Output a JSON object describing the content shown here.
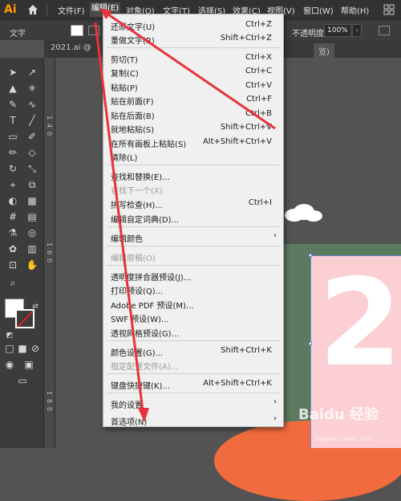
{
  "app": {
    "logo": "Ai"
  },
  "menubar": {
    "items": [
      "文件(F)",
      "编辑(E)",
      "对象(O)",
      "文字(T)",
      "选择(S)",
      "效果(C)",
      "视图(V)",
      "窗口(W)",
      "帮助(H)"
    ],
    "active_index": 1
  },
  "controlbar": {
    "text_label": "文字",
    "opacity_label": "不透明度:",
    "opacity_value": "100%"
  },
  "tabs": {
    "doc_tab": "2021.ai @",
    "second_tab": "览)"
  },
  "ruler": {
    "numbers": [
      "1",
      "4",
      "0",
      "1",
      "6",
      "0",
      "1",
      "8",
      "0"
    ]
  },
  "artwork": {
    "digit": "2"
  },
  "edit_menu": {
    "items": [
      {
        "label": "还原文字(U)",
        "shortcut": "Ctrl+Z"
      },
      {
        "label": "重做文字(R)",
        "shortcut": "Shift+Ctrl+Z"
      },
      {
        "label": "剪切(T)",
        "shortcut": "Ctrl+X"
      },
      {
        "label": "复制(C)",
        "shortcut": "Ctrl+C"
      },
      {
        "label": "粘贴(P)",
        "shortcut": "Ctrl+V"
      },
      {
        "label": "贴在前面(F)",
        "shortcut": "Ctrl+F"
      },
      {
        "label": "贴在后面(B)",
        "shortcut": "Ctrl+B"
      },
      {
        "label": "就地粘贴(S)",
        "shortcut": "Shift+Ctrl+V"
      },
      {
        "label": "在所有画板上粘贴(S)",
        "shortcut": "Alt+Shift+Ctrl+V"
      },
      {
        "label": "清除(L)",
        "shortcut": ""
      },
      {
        "label": "查找和替换(E)...",
        "shortcut": ""
      },
      {
        "label": "查找下一个(X)",
        "shortcut": ""
      },
      {
        "label": "拼写检查(H)...",
        "shortcut": "Ctrl+I"
      },
      {
        "label": "编辑自定词典(D)...",
        "shortcut": ""
      },
      {
        "label": "编辑颜色",
        "shortcut": ""
      },
      {
        "label": "编辑原稿(O)",
        "shortcut": ""
      },
      {
        "label": "透明度拼合器预设(J)...",
        "shortcut": ""
      },
      {
        "label": "打印预设(Q)...",
        "shortcut": ""
      },
      {
        "label": "Adobe PDF 预设(M)...",
        "shortcut": ""
      },
      {
        "label": "SWF 预设(W)...",
        "shortcut": ""
      },
      {
        "label": "透视网格预设(G)...",
        "shortcut": ""
      },
      {
        "label": "颜色设置(G)...",
        "shortcut": "Shift+Ctrl+K"
      },
      {
        "label": "指定配置文件(A)...",
        "shortcut": ""
      },
      {
        "label": "键盘快捷键(K)...",
        "shortcut": "Alt+Shift+Ctrl+K"
      },
      {
        "label": "我的设置",
        "shortcut": ""
      },
      {
        "label": "首选项(N)",
        "shortcut": ""
      }
    ]
  },
  "watermark": {
    "text": "Baidu 经验",
    "url": "jingyan.baidu.com"
  },
  "colors": {
    "annotation_red": "#e8323c",
    "menu_bg": "#f0f0f0",
    "pink": "#fbcfd3",
    "green": "#5b7a5f",
    "orange": "#f06b3d"
  }
}
